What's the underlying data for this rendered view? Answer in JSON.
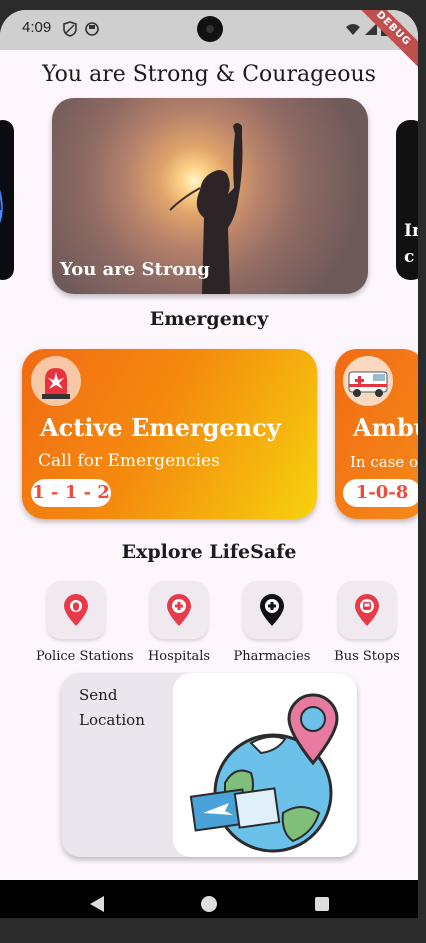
{
  "status": {
    "time": "4:09",
    "debug_banner": "DEBUG"
  },
  "header": {
    "title": "You are Strong & Courageous"
  },
  "carousel": {
    "main_caption": "You are Strong",
    "right_partial": "In c"
  },
  "emergency": {
    "heading": "Emergency",
    "cards": [
      {
        "title": "Active Emergency",
        "subtitle": "Call for Emergencies",
        "number": "1 - 1 - 2"
      },
      {
        "title": "Ambu",
        "subtitle": "In case o",
        "number": "1-0-8"
      }
    ]
  },
  "explore": {
    "heading": "Explore LifeSafe",
    "items": [
      {
        "label": "Police Stations",
        "icon": "police-pin-icon"
      },
      {
        "label": "Hospitals",
        "icon": "hospital-pin-icon"
      },
      {
        "label": "Pharmacies",
        "icon": "pharmacy-pin-icon"
      },
      {
        "label": "Bus Stops",
        "icon": "bus-pin-icon"
      }
    ]
  },
  "send_location": {
    "label": "Send Location"
  },
  "colors": {
    "accent_orange": "#f26b14",
    "accent_yellow": "#f6d20e",
    "pin_red": "#e83b4a",
    "background": "#fdf7fd"
  }
}
